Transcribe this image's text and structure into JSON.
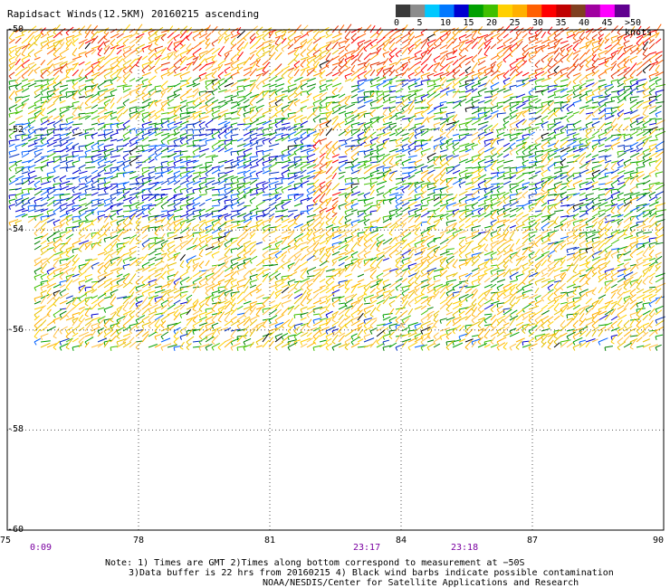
{
  "title": "Rapidsact Winds(12.5KM) 20160215 ascending",
  "colorbar": {
    "colors": [
      "#3a3a3a",
      "#8c8c8c",
      "#00c8ff",
      "#0078ff",
      "#0000d0",
      "#00a000",
      "#40c000",
      "#ffd000",
      "#ffb000",
      "#ff6000",
      "#ff0000",
      "#c00000",
      "#804020",
      "#a000a0",
      "#ff00ff",
      "#600090"
    ],
    "labels": [
      "0",
      "5",
      "10",
      "15",
      "20",
      "25",
      "30",
      "35",
      "40",
      "45",
      ">50 knots"
    ]
  },
  "x_axis": {
    "ticks": [
      "75",
      "78",
      "81",
      "84",
      "87",
      "90"
    ]
  },
  "y_axis": {
    "ticks": [
      "-50",
      "-52",
      "-54",
      "-56",
      "-58",
      "-60"
    ]
  },
  "times": [
    "0:09",
    "23:17",
    "23:18"
  ],
  "notes": [
    "Note: 1) Times are GMT 2)Times along bottom correspond to measurement at −50S",
    "3)Data buffer is 22 hrs from 20160215 4) Black wind barbs indicate possible contamination",
    "NOAA/NESDIS/Center for Satellite Applications and Research"
  ]
}
